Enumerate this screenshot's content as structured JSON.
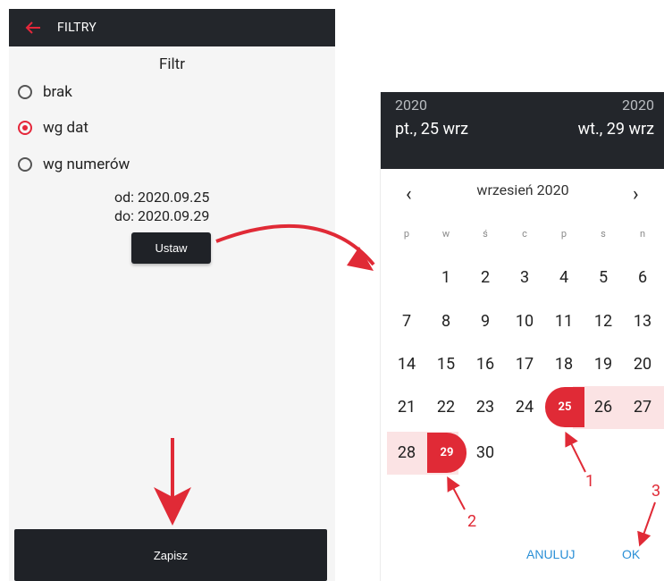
{
  "left": {
    "title": "FILTRY",
    "section_title": "Filtr",
    "options": [
      "brak",
      "wg dat",
      "wg numerów"
    ],
    "selected_option": "wg dat",
    "range": {
      "from_label": "od:",
      "from_value": "2020.09.25",
      "to_label": "do:",
      "to_value": "2020.09.29"
    },
    "set_button": "Ustaw",
    "save_button": "Zapisz"
  },
  "picker": {
    "start_year": "2020",
    "end_year": "2020",
    "start_date": "pt., 25 wrz",
    "end_date": "wt., 29 wrz",
    "month": "wrzesień 2020",
    "prev": "‹",
    "next": "›",
    "weekdays": [
      "p",
      "w",
      "ś",
      "c",
      "p",
      "s",
      "n"
    ],
    "days": [
      "1",
      "2",
      "3",
      "4",
      "5",
      "6",
      "7",
      "8",
      "9",
      "10",
      "11",
      "12",
      "13",
      "14",
      "15",
      "16",
      "17",
      "18",
      "19",
      "20",
      "21",
      "22",
      "23",
      "24",
      "25",
      "26",
      "27",
      "28",
      "29",
      "30"
    ],
    "range_start": "25",
    "range_end": "29",
    "cancel": "ANULUJ",
    "ok": "OK"
  },
  "annotations": [
    "1",
    "2",
    "3"
  ],
  "colors": {
    "accent": "#e02a36",
    "dark": "#23262b",
    "range": "#fbe3e4",
    "link": "#2a8fd6"
  }
}
